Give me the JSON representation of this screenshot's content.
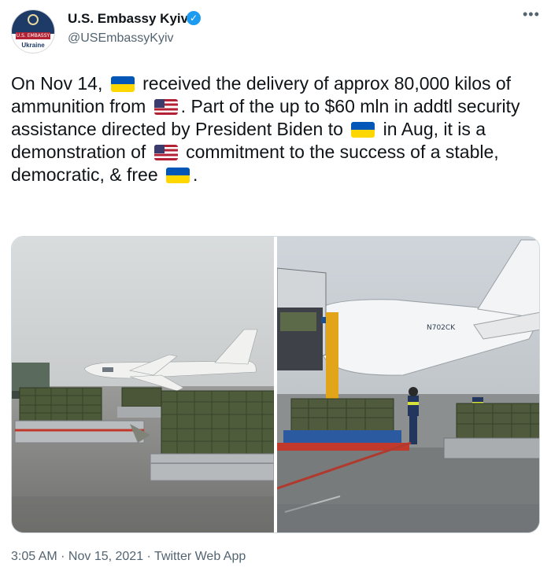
{
  "user": {
    "name": "U.S. Embassy Kyiv",
    "handle": "@USEmbassyKyiv",
    "avatar_banner": "U.S. EMBASSY",
    "avatar_sub": "Ukraine",
    "verified_icon": "verified-badge-icon"
  },
  "more_label": "•••",
  "tweet": {
    "p1": "On Nov 14,",
    "p2": "received the delivery of approx 80,000 kilos of ammunition from",
    "p3": ". Part of the up to $60 mln in addtl security assistance directed by President Biden to",
    "p4": "in Aug, it is a demonstration of",
    "p5": "commitment to the success of a stable, democratic, & free",
    "p6": ".",
    "flags": [
      "ukraine-flag",
      "us-flag",
      "ukraine-flag",
      "us-flag",
      "ukraine-flag"
    ]
  },
  "media": {
    "right_photo_tail_number": "N702CK"
  },
  "meta": {
    "time": "3:05 AM",
    "sep1": " · ",
    "date": "Nov 15, 2021",
    "sep2": " · ",
    "source": "Twitter Web App"
  },
  "colors": {
    "text": "#0f1419",
    "secondary": "#536471",
    "verified": "#1d9bf0",
    "ua_blue": "#0057b7",
    "ua_yellow": "#ffd700"
  }
}
